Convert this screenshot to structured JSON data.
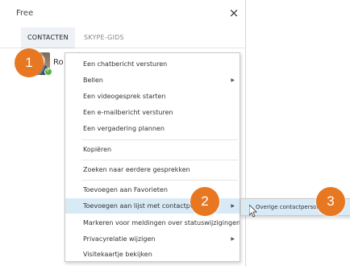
{
  "window": {
    "title": "Free",
    "close_label": "×"
  },
  "tabs": [
    {
      "label": "CONTACTEN"
    },
    {
      "label": "SKYPE-GIDS"
    }
  ],
  "contact": {
    "name": "Ro",
    "status": "online"
  },
  "context_menu": {
    "items": [
      {
        "label": "Een chatbericht versturen"
      },
      {
        "label": "Bellen"
      },
      {
        "label": "Een videogesprek starten"
      },
      {
        "label": "Een e-mailbericht versturen"
      },
      {
        "label": "Een vergadering plannen"
      },
      {
        "label": "Kopiëren"
      },
      {
        "label": "Zoeken naar eerdere gesprekken"
      },
      {
        "label": "Toevoegen aan Favorieten"
      },
      {
        "label": "Toevoegen aan lijst met contactpersonen"
      },
      {
        "label": "Markeren voor meldingen over statuswijzigingen"
      },
      {
        "label": "Privacyrelatie wijzigen"
      },
      {
        "label": "Visitekaartje bekijken"
      }
    ],
    "submenu": {
      "items": [
        {
          "label": "Overige contactpersonen"
        }
      ]
    }
  },
  "badges": [
    "1",
    "2",
    "3"
  ],
  "colors": {
    "badge": "#e87722",
    "highlight": "#d9eaf7",
    "presence": "#59b442"
  }
}
